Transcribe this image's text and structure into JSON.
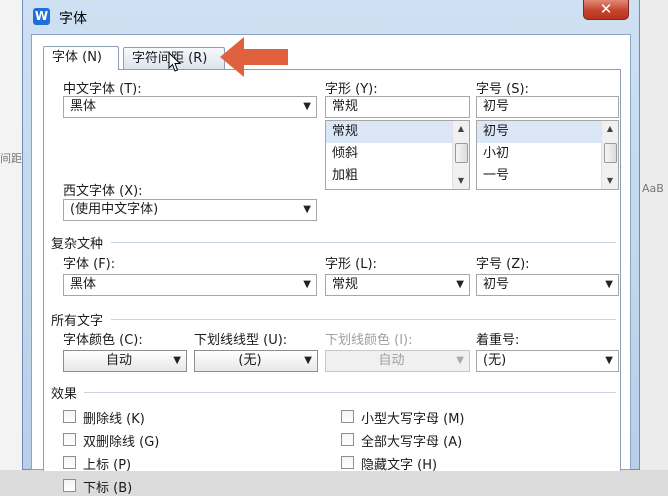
{
  "background": {
    "left_text": "间距",
    "right_text": "AaB"
  },
  "window": {
    "app_icon": "W",
    "title": "字体",
    "close_label": "✕"
  },
  "tabs": [
    {
      "label": "字体 (N)"
    },
    {
      "label": "字符间距 (R)"
    }
  ],
  "latin_group": {
    "cn_font_label": "中文字体 (T):",
    "cn_font_value": "黑体",
    "style_label": "字形 (Y):",
    "style_value": "常规",
    "style_options": [
      "常规",
      "倾斜",
      "加粗"
    ],
    "size_label": "字号 (S):",
    "size_value": "初号",
    "size_options": [
      "初号",
      "小初",
      "一号"
    ],
    "west_font_label": "西文字体 (X):",
    "west_font_value": "(使用中文字体)"
  },
  "complex_group": {
    "heading": "复杂文种",
    "font_label": "字体 (F):",
    "font_value": "黑体",
    "style_label": "字形 (L):",
    "style_value": "常规",
    "size_label": "字号 (Z):",
    "size_value": "初号"
  },
  "all_text_group": {
    "heading": "所有文字",
    "color_label": "字体颜色 (C):",
    "color_value": "自动",
    "underline_label": "下划线线型 (U):",
    "underline_value": "(无)",
    "underline_color_label": "下划线颜色 (I):",
    "underline_color_value": "自动",
    "emphasis_label": "着重号:",
    "emphasis_value": "(无)"
  },
  "effects_group": {
    "heading": "效果",
    "left": [
      "删除线 (K)",
      "双删除线 (G)",
      "上标 (P)",
      "下标 (B)"
    ],
    "right": [
      "小型大写字母 (M)",
      "全部大写字母 (A)",
      "隐藏文字 (H)"
    ]
  },
  "colors": {
    "accent_arrow": "#e0613e",
    "selection": "#dbe6f6"
  }
}
